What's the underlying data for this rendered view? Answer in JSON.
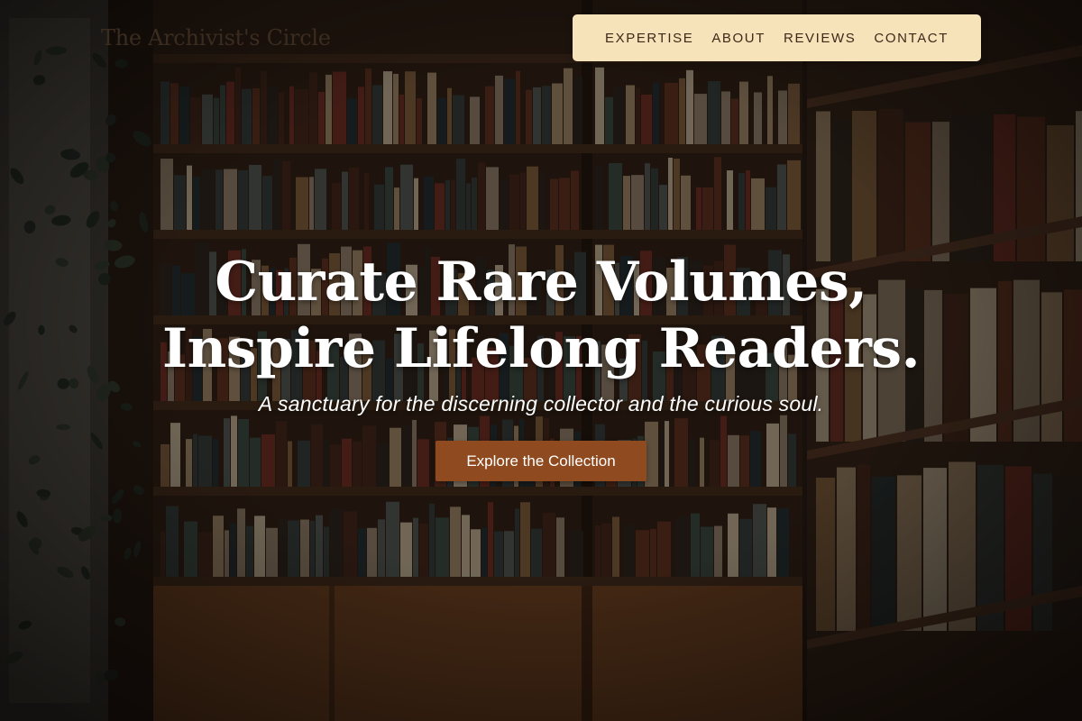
{
  "site": {
    "logo_text": "The Archivist's Circle"
  },
  "nav": {
    "links": [
      {
        "label": "EXPERTISE"
      },
      {
        "label": "ABOUT"
      },
      {
        "label": "REVIEWS"
      },
      {
        "label": "CONTACT"
      }
    ],
    "background_color": "#f6e3b9"
  },
  "hero": {
    "headline_line1": "Curate Rare Volumes,",
    "headline_line2": "Inspire Lifelong Readers.",
    "tagline": "A sanctuary for the discerning collector and the curious soul.",
    "cta_label": "Explore the Collection",
    "cta_color": "#8f4a1f",
    "background_image": "bookshelves-icon"
  }
}
